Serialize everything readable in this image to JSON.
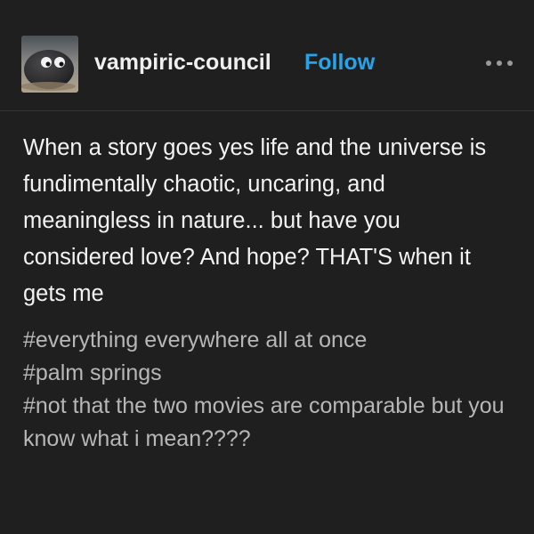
{
  "post": {
    "avatar": "stone-with-googly-eyes",
    "username": "vampiric-council",
    "follow_label": "Follow",
    "more_icon": "more-dots-icon",
    "body": "When a story goes yes life and the universe is fundimentally chaotic, uncaring, and meaningless in nature... but have you considered love? And hope? THAT'S when it gets me",
    "tags": [
      "#everything everywhere all at once",
      "#palm springs",
      "#not that the two movies are comparable but you know what i mean????"
    ]
  },
  "colors": {
    "background": "#1f1f1f",
    "text": "#f3f3f3",
    "tag_text": "#b7b7b7",
    "follow_accent": "#27a4e8"
  }
}
